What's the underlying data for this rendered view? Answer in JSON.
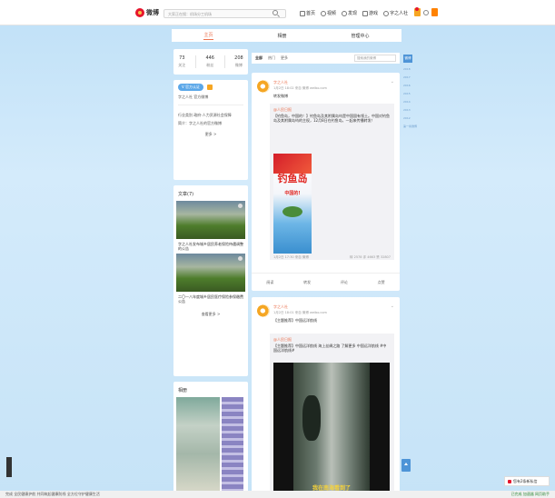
{
  "topbar": {
    "logo": "微博",
    "search_placeholder": "大家正在搜：机场分工机场",
    "nav": [
      "首页",
      "视频",
      "发现",
      "游戏",
      "字之人社"
    ],
    "colors": {
      "brand": "#e6162d",
      "accent": "#eb7350"
    }
  },
  "profile_tabs": [
    "主页",
    "相册",
    "管理中心"
  ],
  "stats": [
    {
      "num": "73",
      "label": "关注"
    },
    {
      "num": "446",
      "label": "粉丝"
    },
    {
      "num": "208",
      "label": "微博"
    }
  ],
  "info": {
    "v_label": "V 官方认证",
    "desc": "字之人社 官方微博",
    "lines": [
      "行业类别 政府-人力资源社会保障",
      "简介：字之人社的官方微博"
    ],
    "more": "更多 >"
  },
  "articles": {
    "title": "文章(7)",
    "items": [
      "字之人社发布城乡居民养老保险待遇调整的公告",
      "二〇一八年度城乡居民医疗保险参保缴费公告"
    ],
    "see_more": "查看更多 >"
  },
  "photos": {
    "title": "相册"
  },
  "feed": {
    "tabs": [
      "全部",
      "热门",
      "更多"
    ],
    "search_placeholder": "搜索我的微博"
  },
  "posts": [
    {
      "name": "字之人社",
      "meta": "1月2日 18:02 来自 微博 weibo.com",
      "text": "转发微博",
      "repost_user": "@人民日报",
      "repost_text": "【钓鱼岛，中国的！】钓鱼岛及其附属岛屿是中国固有领土。中国对钓鱼岛及其附属岛屿的主权，12月8日在钓鱼岛，一起来传播转发！",
      "poster_title": "钓鱼岛",
      "poster_sub": "中国的!",
      "repost_meta": "1月2日 17:30 来自 微博",
      "repost_counts": "转 2578  评 4663  赞 32807",
      "actions": [
        "阅读",
        "转发",
        "评论",
        "点赞"
      ]
    },
    {
      "name": "字之人社",
      "meta": "1月2日 18:01 来自 微博 weibo.com",
      "text": "【主题推荐】中国远洋航线",
      "repost_user": "@人民日报",
      "repost_text": "【主题推荐】中国远洋航线 海上丝绸之路 了解更多 中国远洋航线  #中国远洋航线#",
      "video_caption": "我在南海看到了"
    }
  ],
  "right_tabs": [
    "微博",
    "2018",
    "2017",
    "2016",
    "2015",
    "2014",
    "2013",
    "2012",
    "第一条微博"
  ],
  "statusbar": {
    "left": "完成   全民健康护航 共同筑起健康防线 全方位守护健康生活",
    "right": "已完成 加速器 网页助手"
  },
  "notice": "您有2条新私信"
}
